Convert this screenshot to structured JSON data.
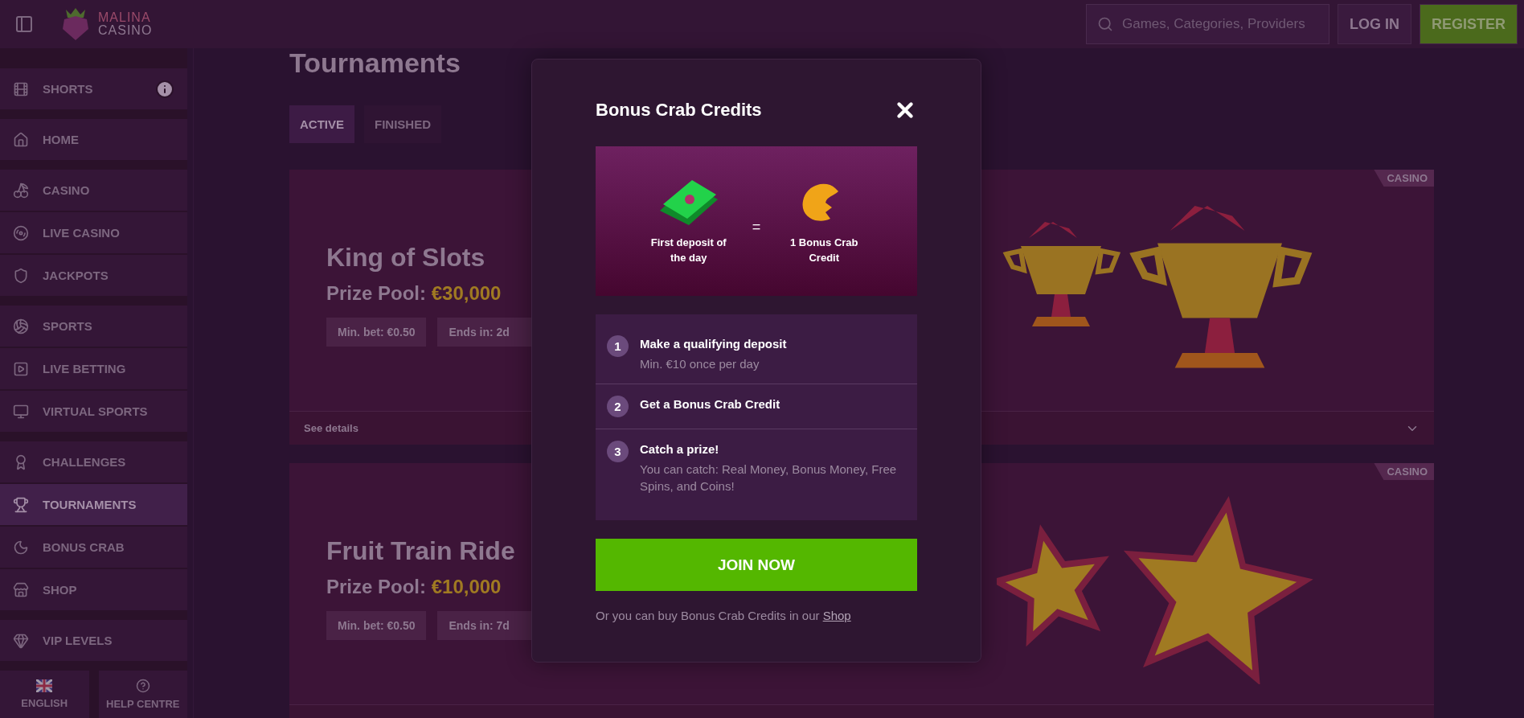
{
  "header": {
    "logo": {
      "line1": "MALINA",
      "line2": "CASINO"
    },
    "search": {
      "placeholder": "Games, Categories, Providers"
    },
    "login": "LOG IN",
    "register": "REGISTER"
  },
  "sidebar": {
    "groups": [
      {
        "items": [
          {
            "label": "SHORTS",
            "selected": false,
            "info": true
          }
        ]
      },
      {
        "items": [
          {
            "label": "HOME",
            "selected": false,
            "info": false
          }
        ]
      },
      {
        "items": [
          {
            "label": "CASINO",
            "selected": false,
            "info": false
          },
          {
            "label": "LIVE CASINO",
            "selected": false,
            "info": false
          },
          {
            "label": "JACKPOTS",
            "selected": false,
            "info": false
          }
        ]
      },
      {
        "items": [
          {
            "label": "SPORTS",
            "selected": false,
            "info": false
          },
          {
            "label": "LIVE BETTING",
            "selected": false,
            "info": false
          },
          {
            "label": "VIRTUAL SPORTS",
            "selected": false,
            "info": false
          }
        ]
      },
      {
        "items": [
          {
            "label": "CHALLENGES",
            "selected": false,
            "info": false
          },
          {
            "label": "TOURNAMENTS",
            "selected": true,
            "info": false
          },
          {
            "label": "BONUS CRAB",
            "selected": false,
            "info": false
          },
          {
            "label": "SHOP",
            "selected": false,
            "info": false
          }
        ]
      },
      {
        "items": [
          {
            "label": "VIP LEVELS",
            "selected": false,
            "info": false
          }
        ]
      }
    ],
    "footer": [
      {
        "label": "ENGLISH"
      },
      {
        "label": "HELP CENTRE"
      }
    ]
  },
  "page": {
    "title": "Tournaments",
    "tabs": [
      {
        "label": "ACTIVE",
        "selected": true
      },
      {
        "label": "FINISHED",
        "selected": false
      }
    ],
    "cards": [
      {
        "tag": "CASINO",
        "title": "King of Slots",
        "prize_label": "Prize Pool:",
        "prize": "€30,000",
        "pills": [
          "Min. bet: €0.50",
          "Ends in: 2d"
        ],
        "details": "See details"
      },
      {
        "tag": "CASINO",
        "title": "Fruit Train Ride",
        "prize_label": "Prize Pool:",
        "prize": "€10,000",
        "pills": [
          "Min. bet: €0.50",
          "Ends in: 7d"
        ]
      }
    ]
  },
  "modal": {
    "title": "Bonus Crab Credits",
    "banner": {
      "left": "First deposit of the day",
      "equals": "=",
      "right": "1 Bonus Crab Credit"
    },
    "steps": [
      {
        "number": "1",
        "title": "Make a qualifying deposit",
        "description": "Min. €10 once per day"
      },
      {
        "number": "2",
        "title": "Get a Bonus Crab Credit"
      },
      {
        "number": "3",
        "title": "Catch a prize!",
        "description": "You can catch: Real Money, Bonus Money, Free Spins, and Coins!"
      }
    ],
    "button": "JOIN NOW",
    "footer_text": "Or you can buy Bonus Crab Credits in our ",
    "footer_link": "Shop"
  }
}
